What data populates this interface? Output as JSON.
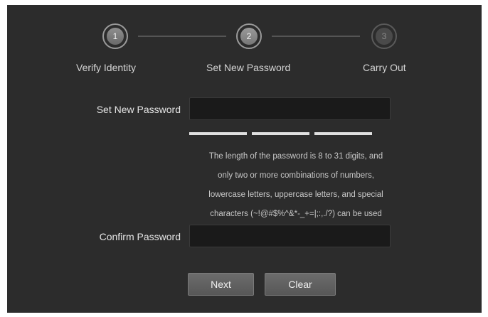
{
  "stepper": {
    "steps": [
      {
        "number": "1",
        "label": "Verify Identity",
        "state": "done"
      },
      {
        "number": "2",
        "label": "Set New Password",
        "state": "active"
      },
      {
        "number": "3",
        "label": "Carry Out",
        "state": "pending"
      }
    ]
  },
  "form": {
    "new_password_label": "Set New Password",
    "new_password_value": "",
    "confirm_password_label": "Confirm Password",
    "confirm_password_value": "",
    "strength_segments": 3,
    "hint_lines": [
      "The length of the password is 8 to 31 digits, and",
      "only two or more combinations of numbers,",
      "lowercase letters, uppercase letters, and special",
      "characters (~!@#$%^&*-_+=|;:,./?) can be used"
    ]
  },
  "buttons": {
    "next_label": "Next",
    "clear_label": "Clear"
  },
  "colors": {
    "panel_bg": "#2c2c2c",
    "input_bg": "#1a1a1a",
    "button_bg": "#626262",
    "text": "#e6e6e6"
  }
}
